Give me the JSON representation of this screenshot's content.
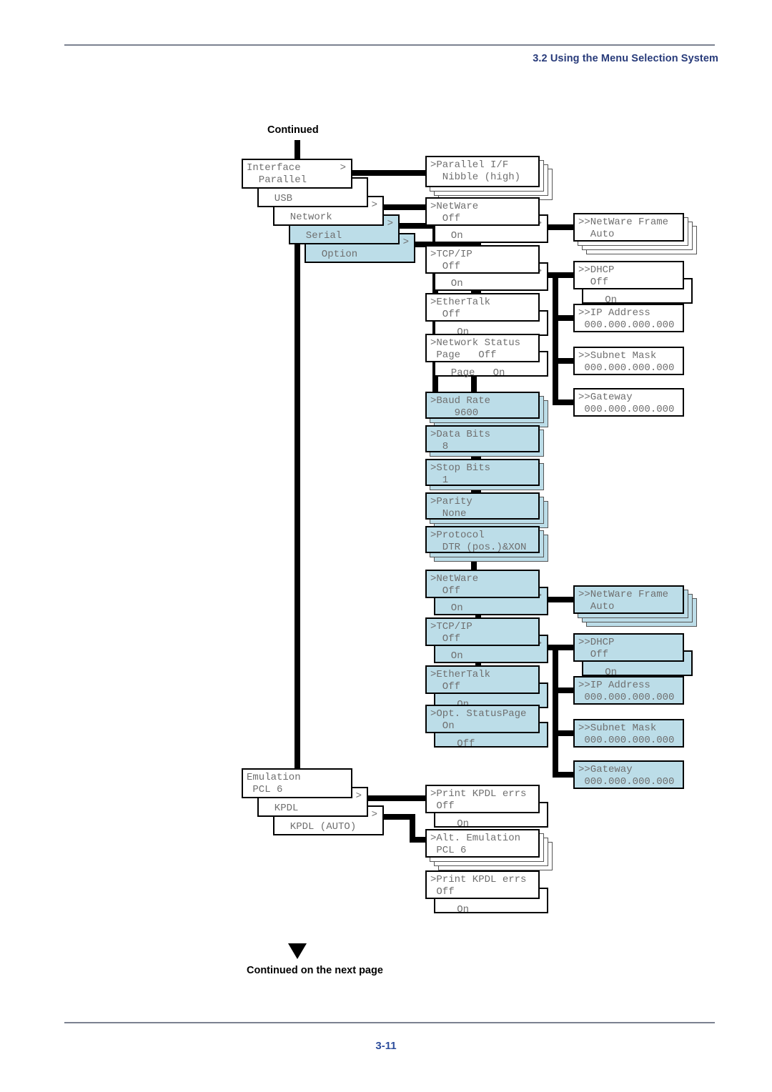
{
  "header": {
    "title": "3.2 Using the Menu Selection System"
  },
  "footer": {
    "page_number": "3-11"
  },
  "labels": {
    "continued": "Continued",
    "continued_next": "Continued on the next page"
  },
  "arrow_glyph": ">",
  "colors": {
    "highlight": "#bcdde8",
    "header_text": "#283b7a",
    "page_number": "#2e4e9c",
    "lcd_text": "#6f6f6f",
    "line": "#000000"
  },
  "interface_menu": [
    {
      "line1": "Interface",
      "line2": "  Parallel",
      "arrow": ">",
      "highlight": false
    },
    {
      "line1": "Interface",
      "line2": "  USB",
      "arrow": "",
      "highlight": false
    },
    {
      "line1": "Interface",
      "line2": "  Network",
      "arrow": ">",
      "highlight": false
    },
    {
      "line1": "Interface",
      "line2": "  Serial",
      "arrow": ">",
      "highlight": true
    },
    {
      "line1": "Interface",
      "line2": "  Option",
      "arrow": ">",
      "highlight": true
    }
  ],
  "parallel": {
    "box": {
      "line1": ">Parallel I/F",
      "line2": "  Nibble (high)",
      "arrow": "",
      "highlight": false,
      "sheets": 3
    }
  },
  "network": {
    "netware": {
      "line1": ">NetWare",
      "line2": "  Off",
      "alt": "  On",
      "alt_arrow": ">",
      "alt_line1": ">NetWare",
      "highlight": false
    },
    "netware_frame": {
      "line1": ">>NetWare Frame",
      "line2": "  Auto",
      "highlight": false,
      "sheets": 3
    },
    "tcpip": {
      "line1": ">TCP/IP",
      "line2": "  Off",
      "alt": "  On",
      "alt_arrow": ">",
      "alt_line1": ">TCP/IP",
      "highlight": false
    },
    "ethertalk": {
      "line1": ">EtherTalk",
      "line2": "  Off",
      "alt": "   On",
      "alt_arrow": "",
      "alt_line1": "",
      "highlight": false
    },
    "netstatus": {
      "line1": ">Network Status",
      "line2": " Page   Off",
      "alt": "  Page   On",
      "alt_arrow": "",
      "alt_line1": "",
      "highlight": false
    },
    "dhcp": {
      "line1": ">>DHCP",
      "line2": "  Off",
      "alt": "   On",
      "highlight": false
    },
    "ip": {
      "line1": ">>IP Address",
      "line2": " 000.000.000.000",
      "highlight": false
    },
    "subnet": {
      "line1": ">>Subnet Mask",
      "line2": " 000.000.000.000",
      "highlight": false
    },
    "gateway": {
      "line1": ">>Gateway",
      "line2": " 000.000.000.000",
      "highlight": false
    }
  },
  "serial": [
    {
      "line1": ">Baud Rate",
      "line2": "    9600",
      "highlight": true,
      "sheets": 2
    },
    {
      "line1": ">Data Bits",
      "line2": "  8",
      "highlight": true,
      "sheets": 1
    },
    {
      "line1": ">Stop Bits",
      "line2": "  1",
      "highlight": true,
      "sheets": 1
    },
    {
      "line1": ">Parity",
      "line2": "  None",
      "highlight": true,
      "sheets": 2
    },
    {
      "line1": ">Protocol",
      "line2": "  DTR (pos.)&XON",
      "highlight": true,
      "sheets": 2
    }
  ],
  "option": {
    "netware": {
      "line1": ">NetWare",
      "line2": "  Off",
      "alt": "  On",
      "alt_arrow": ">",
      "alt_line1": ">NetWare",
      "highlight": true
    },
    "netware_frame": {
      "line1": ">>NetWare Frame",
      "line2": "  Auto",
      "highlight": true,
      "sheets": 3
    },
    "tcpip": {
      "line1": ">TCP/IP",
      "line2": "  Off",
      "alt": "  On",
      "alt_arrow": ">",
      "alt_line1": ">TCP/IP",
      "highlight": true
    },
    "ethertalk": {
      "line1": ">EtherTalk",
      "line2": "  Off",
      "alt": "   On",
      "alt_arrow": "",
      "alt_line1": "",
      "highlight": true
    },
    "optstatus": {
      "line1": ">Opt. StatusPage",
      "line2": "  On",
      "alt": "   Off",
      "alt_arrow": "",
      "alt_line1": "",
      "highlight": true
    },
    "dhcp": {
      "line1": ">>DHCP",
      "line2": "  Off",
      "alt": "   On",
      "highlight": true
    },
    "ip": {
      "line1": ">>IP Address",
      "line2": " 000.000.000.000",
      "highlight": true
    },
    "subnet": {
      "line1": ">>Subnet Mask",
      "line2": " 000.000.000.000",
      "highlight": true
    },
    "gateway": {
      "line1": ">>Gateway",
      "line2": " 000.000.000.000",
      "highlight": true
    }
  },
  "emulation_menu": [
    {
      "line1": "Emulation",
      "line2": " PCL 6",
      "arrow": "",
      "highlight": false
    },
    {
      "line1": "Emulation",
      "line2": "  KPDL",
      "arrow": ">",
      "highlight": false
    },
    {
      "line1": "Emulation",
      "line2": "  KPDL (AUTO)",
      "arrow": ">",
      "highlight": false
    }
  ],
  "emulation_children": {
    "print_kpdl_errs_1": {
      "line1": ">Print KPDL errs",
      "line2": " Off",
      "alt": "   On",
      "highlight": false
    },
    "alt_emulation": {
      "line1": ">Alt. Emulation",
      "line2": " PCL 6",
      "highlight": false,
      "sheets": 3
    },
    "print_kpdl_errs_2": {
      "line1": ">Print KPDL errs",
      "line2": " Off",
      "alt": "   On",
      "highlight": false
    }
  }
}
